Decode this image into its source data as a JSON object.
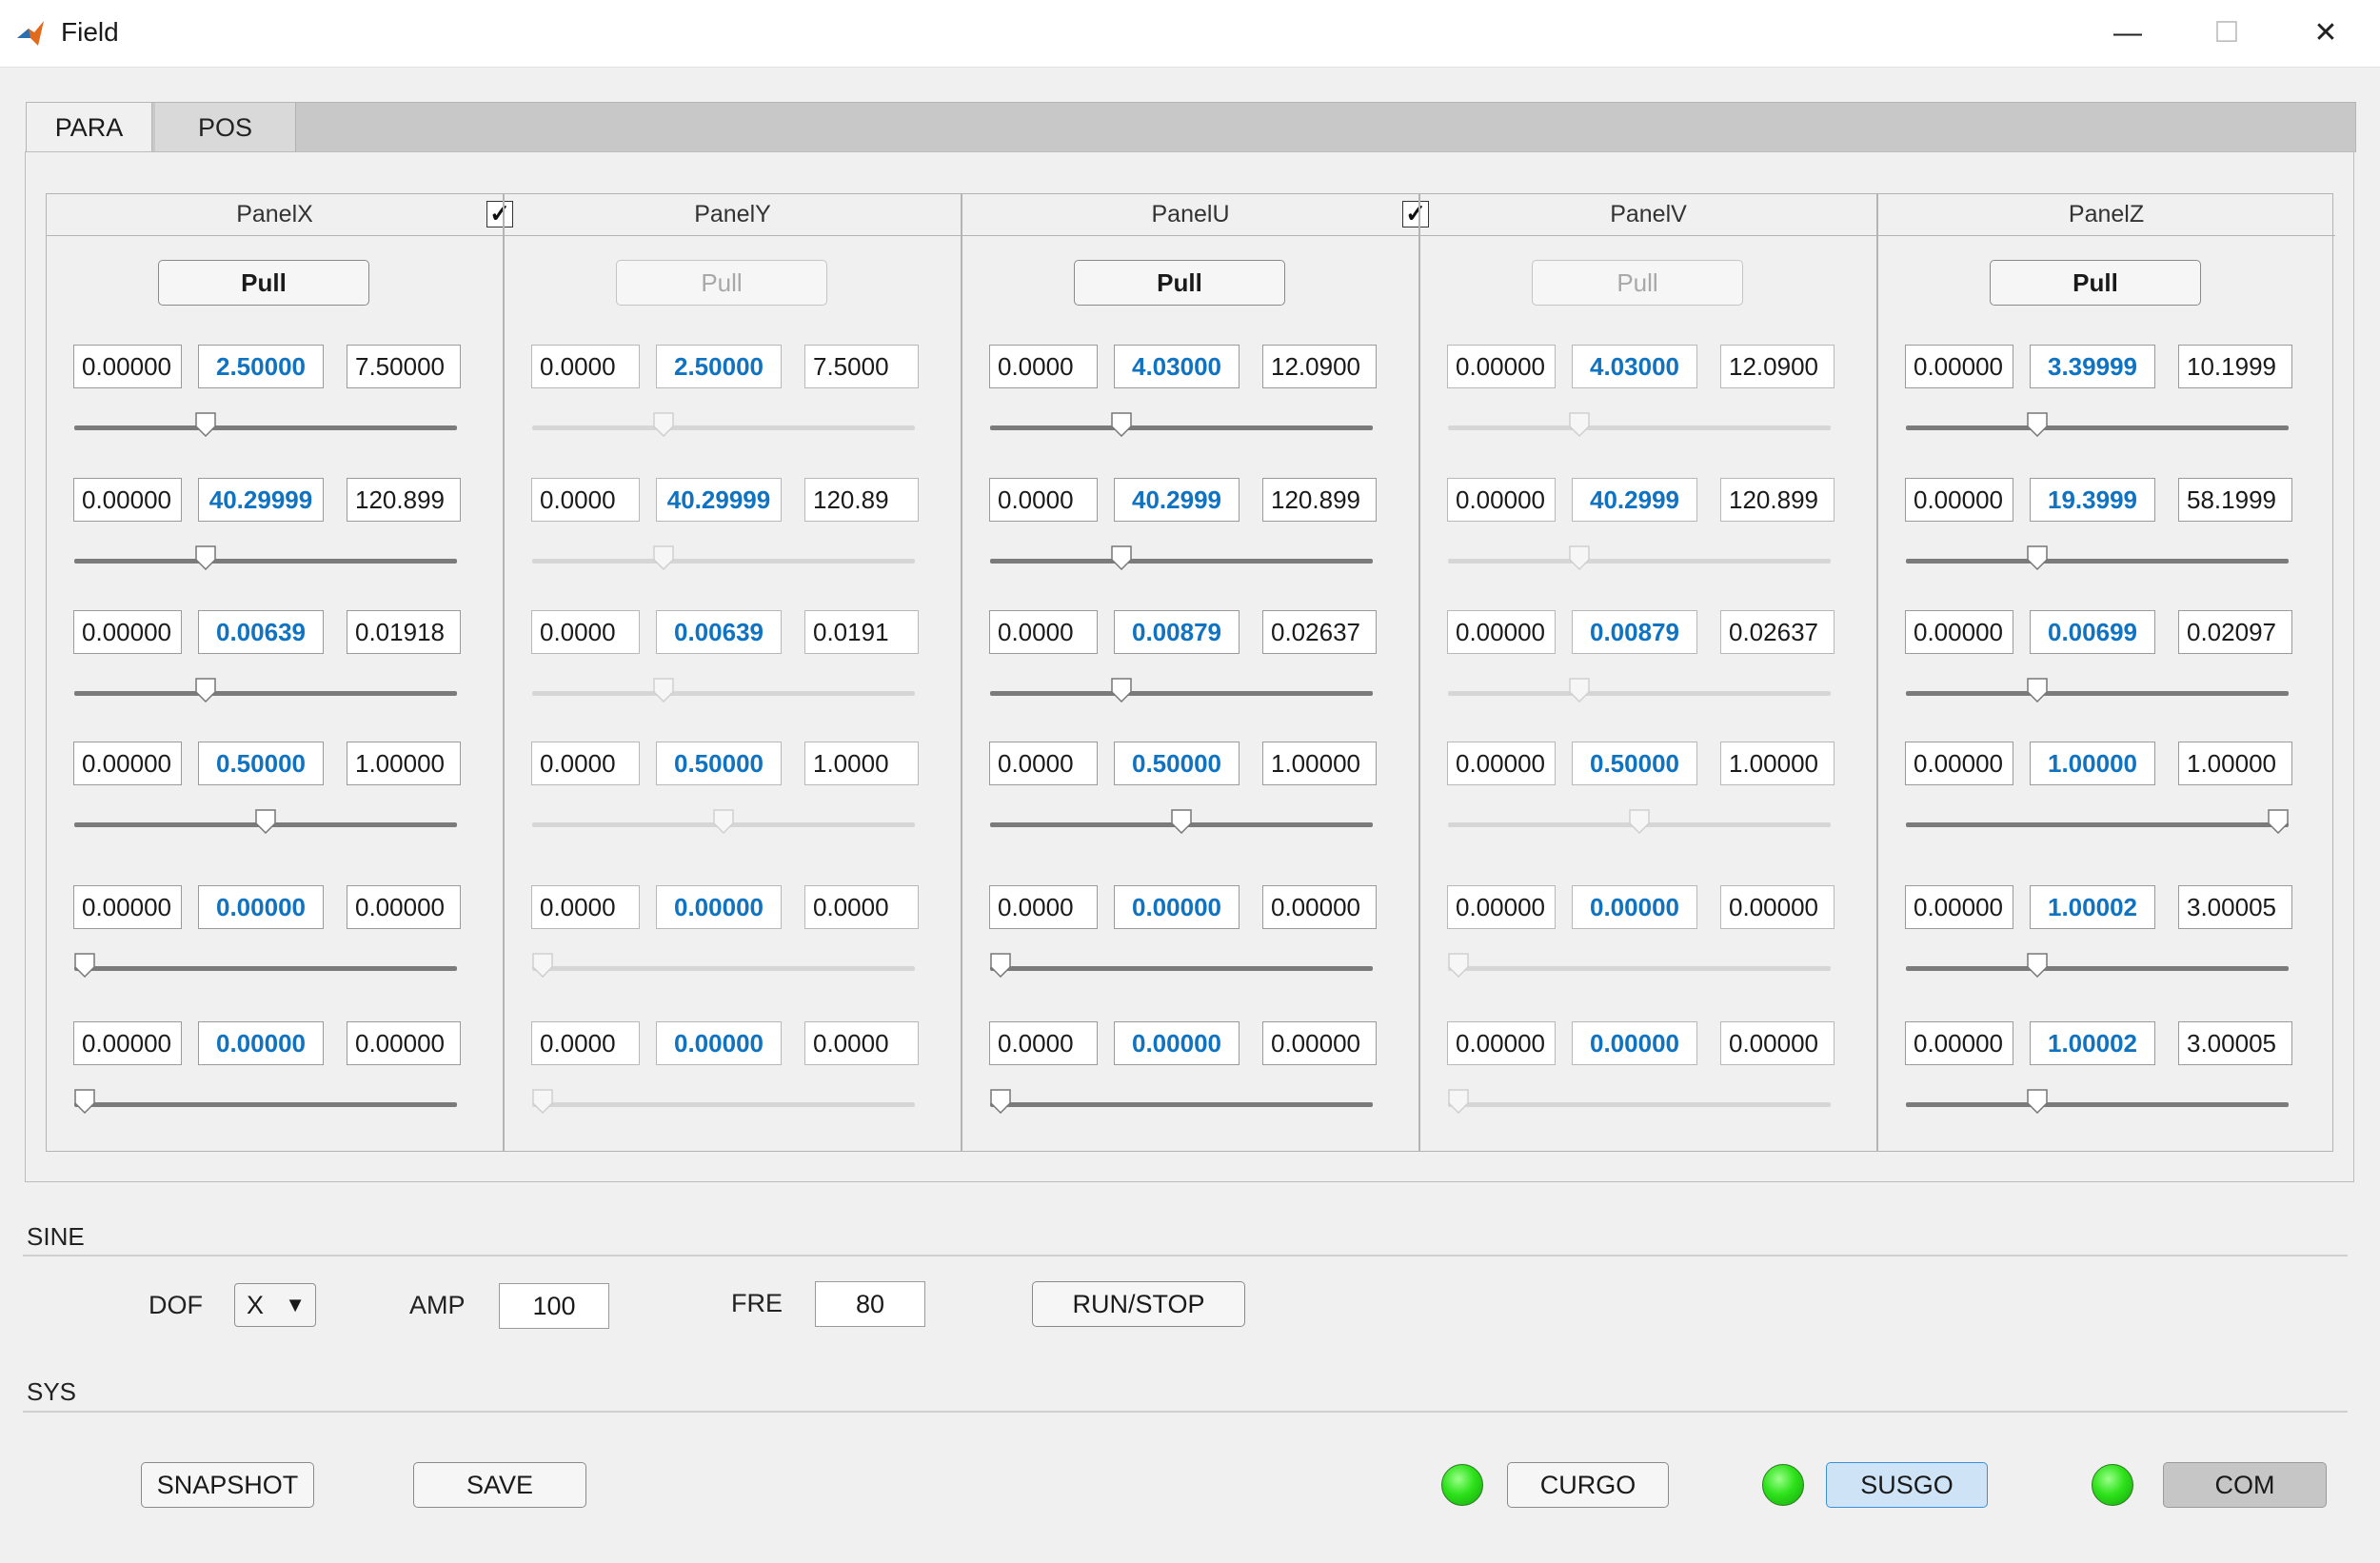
{
  "window": {
    "title": "Field",
    "minimize_glyph": "—",
    "maximize_glyph": "☐",
    "close_glyph": "✕"
  },
  "tabs": [
    {
      "label": "PARA",
      "active": true
    },
    {
      "label": "POS",
      "active": false
    }
  ],
  "panels": [
    {
      "name": "PanelX",
      "enabled": true,
      "pull_label": "Pull",
      "checkbox_after": true,
      "rows": [
        {
          "min": "0.00000",
          "val": "2.50000",
          "max": "7.50000",
          "pos": 0.333
        },
        {
          "min": "0.00000",
          "val": "40.29999",
          "max": "120.899",
          "pos": 0.333
        },
        {
          "min": "0.00000",
          "val": "0.00639",
          "max": "0.01918",
          "pos": 0.333
        },
        {
          "min": "0.00000",
          "val": "0.50000",
          "max": "1.00000",
          "pos": 0.5
        },
        {
          "min": "0.00000",
          "val": "0.00000",
          "max": "0.00000",
          "pos": 0.0
        },
        {
          "min": "0.00000",
          "val": "0.00000",
          "max": "0.00000",
          "pos": 0.0
        }
      ]
    },
    {
      "name": "PanelY",
      "enabled": false,
      "pull_label": "Pull",
      "checkbox_after": false,
      "rows": [
        {
          "min": "0.0000",
          "val": "2.50000",
          "max": "7.5000",
          "pos": 0.333
        },
        {
          "min": "0.0000",
          "val": "40.29999",
          "max": "120.89",
          "pos": 0.333
        },
        {
          "min": "0.0000",
          "val": "0.00639",
          "max": "0.0191",
          "pos": 0.333
        },
        {
          "min": "0.0000",
          "val": "0.50000",
          "max": "1.0000",
          "pos": 0.5
        },
        {
          "min": "0.0000",
          "val": "0.00000",
          "max": "0.0000",
          "pos": 0.0
        },
        {
          "min": "0.0000",
          "val": "0.00000",
          "max": "0.0000",
          "pos": 0.0
        }
      ]
    },
    {
      "name": "PanelU",
      "enabled": true,
      "pull_label": "Pull",
      "checkbox_after": true,
      "rows": [
        {
          "min": "0.0000",
          "val": "4.03000",
          "max": "12.0900",
          "pos": 0.333
        },
        {
          "min": "0.0000",
          "val": "40.2999",
          "max": "120.899",
          "pos": 0.333
        },
        {
          "min": "0.0000",
          "val": "0.00879",
          "max": "0.02637",
          "pos": 0.333
        },
        {
          "min": "0.0000",
          "val": "0.50000",
          "max": "1.00000",
          "pos": 0.5
        },
        {
          "min": "0.0000",
          "val": "0.00000",
          "max": "0.00000",
          "pos": 0.0
        },
        {
          "min": "0.0000",
          "val": "0.00000",
          "max": "0.00000",
          "pos": 0.0
        }
      ]
    },
    {
      "name": "PanelV",
      "enabled": false,
      "pull_label": "Pull",
      "checkbox_after": false,
      "rows": [
        {
          "min": "0.00000",
          "val": "4.03000",
          "max": "12.0900",
          "pos": 0.333
        },
        {
          "min": "0.00000",
          "val": "40.2999",
          "max": "120.899",
          "pos": 0.333
        },
        {
          "min": "0.00000",
          "val": "0.00879",
          "max": "0.02637",
          "pos": 0.333
        },
        {
          "min": "0.00000",
          "val": "0.50000",
          "max": "1.00000",
          "pos": 0.5
        },
        {
          "min": "0.00000",
          "val": "0.00000",
          "max": "0.00000",
          "pos": 0.0
        },
        {
          "min": "0.00000",
          "val": "0.00000",
          "max": "0.00000",
          "pos": 0.0
        }
      ]
    },
    {
      "name": "PanelZ",
      "enabled": true,
      "pull_label": "Pull",
      "checkbox_after": false,
      "rows": [
        {
          "min": "0.00000",
          "val": "3.39999",
          "max": "10.1999",
          "pos": 0.333
        },
        {
          "min": "0.00000",
          "val": "19.3999",
          "max": "58.1999",
          "pos": 0.333
        },
        {
          "min": "0.00000",
          "val": "0.00699",
          "max": "0.02097",
          "pos": 0.333
        },
        {
          "min": "0.00000",
          "val": "1.00000",
          "max": "1.00000",
          "pos": 1.0
        },
        {
          "min": "0.00000",
          "val": "1.00002",
          "max": "3.00005",
          "pos": 0.333
        },
        {
          "min": "0.00000",
          "val": "1.00002",
          "max": "3.00005",
          "pos": 0.333
        }
      ]
    }
  ],
  "sine": {
    "section": "SINE",
    "dof_label": "DOF",
    "dof_value": "X",
    "amp_label": "AMP",
    "amp_value": "100",
    "fre_label": "FRE",
    "fre_value": "80",
    "run_label": "RUN/STOP"
  },
  "sys": {
    "section": "SYS",
    "snapshot_label": "SNAPSHOT",
    "save_label": "SAVE",
    "curgo_label": "CURGO",
    "susgo_label": "SUSGO",
    "com_label": "COM",
    "led_color": "#2ee21b"
  }
}
